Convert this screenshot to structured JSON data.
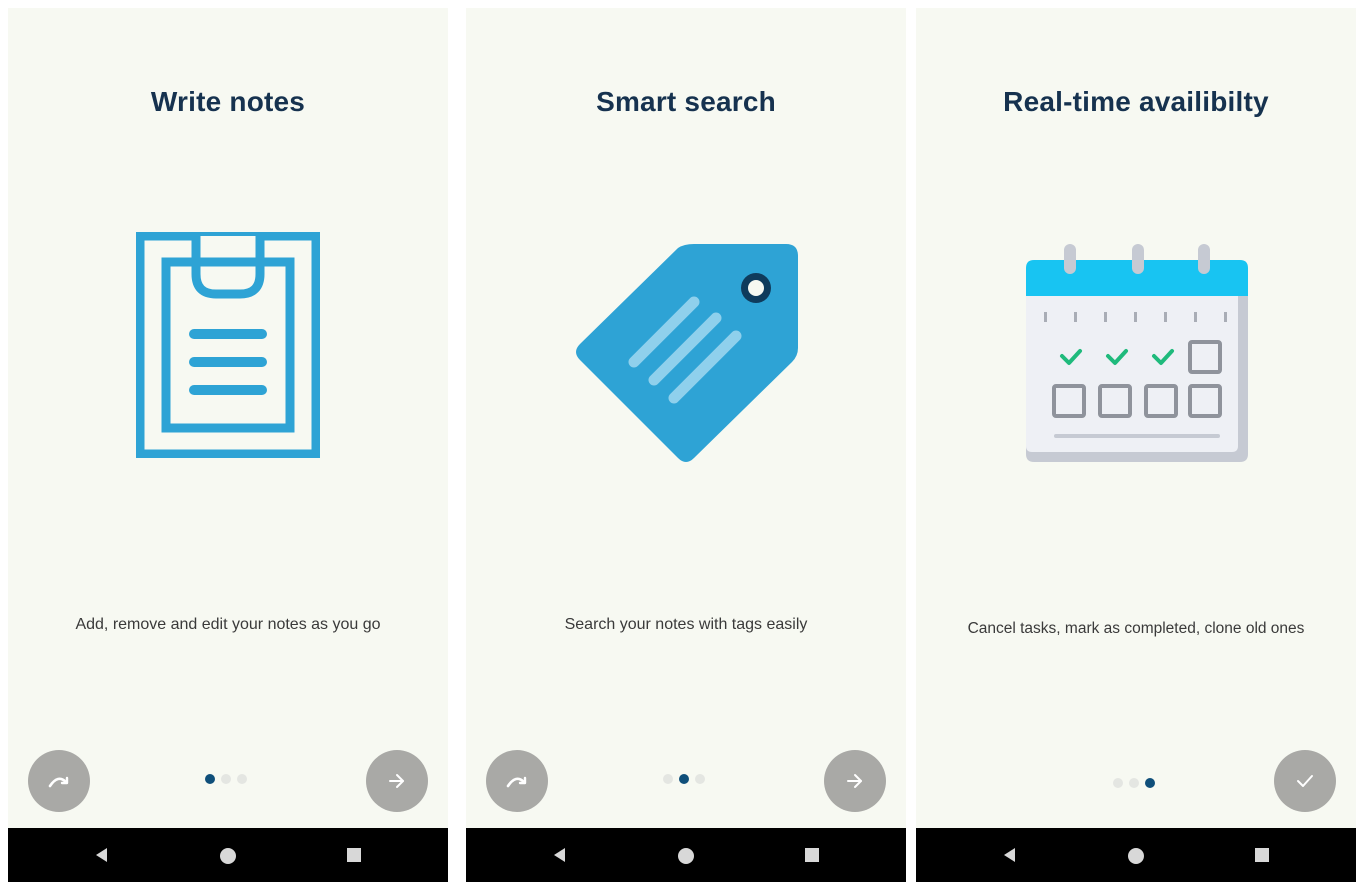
{
  "screens": [
    {
      "title": "Write notes",
      "description": "Add, remove and edit your notes as you go",
      "illustration_icon": "clipboard-icon",
      "page_index": 1,
      "page_count": 3,
      "left_button_icon": "skip-icon",
      "right_button_icon": "arrow-right-icon"
    },
    {
      "title": "Smart search",
      "description": "Search your notes with tags easily",
      "illustration_icon": "tag-icon",
      "page_index": 2,
      "page_count": 3,
      "left_button_icon": "skip-icon",
      "right_button_icon": "arrow-right-icon"
    },
    {
      "title": "Real-time availibilty",
      "description": "Cancel tasks, mark as completed, clone old ones",
      "illustration_icon": "calendar-icon",
      "page_index": 3,
      "page_count": 3,
      "right_button_icon": "checkmark-icon"
    }
  ],
  "navbar": {
    "icons": [
      "back-triangle-icon",
      "home-circle-icon",
      "recent-square-icon"
    ]
  },
  "colors": {
    "background": "#f7f9f2",
    "title": "#16324f",
    "illustration_blue": "#2ea3d5",
    "button_gray": "#a9a9a6",
    "dot_active": "#0f4f7a",
    "dot_inactive": "#e4e6e2",
    "navbar": "#000000"
  }
}
